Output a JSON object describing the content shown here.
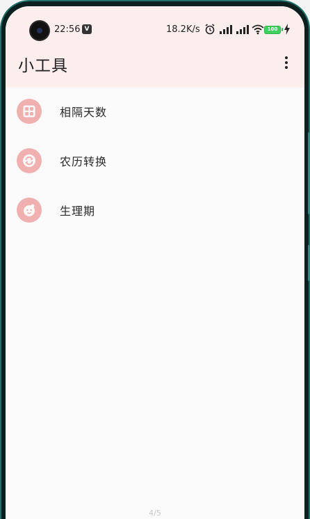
{
  "status_bar": {
    "time": "22:56",
    "badge": "V",
    "network_speed": "18.2K/s",
    "battery_level": "100"
  },
  "app_bar": {
    "title": "小工具"
  },
  "tools": [
    {
      "label": "相隔天数",
      "icon": "calendar-grid-icon"
    },
    {
      "label": "农历转换",
      "icon": "refresh-cycle-icon"
    },
    {
      "label": "生理期",
      "icon": "baby-face-icon"
    }
  ],
  "pager": {
    "text": "4/5"
  },
  "colors": {
    "accent": "#f0b0b0",
    "header_tint": "#fdeeee",
    "frame": "#1f6f6a"
  }
}
